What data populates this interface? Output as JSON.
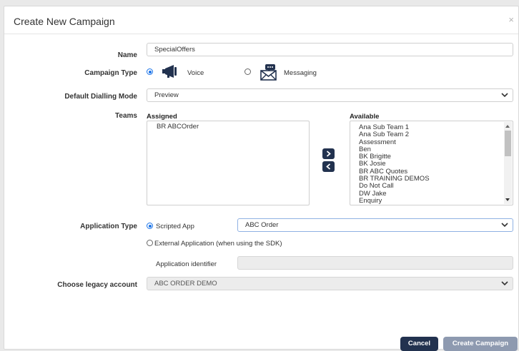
{
  "dialog": {
    "title": "Create New Campaign",
    "close_glyph": "×"
  },
  "form": {
    "name": {
      "label": "Name",
      "value": "SpecialOffers"
    },
    "campaign_type": {
      "label": "Campaign Type",
      "options": [
        {
          "label": "Voice",
          "selected": true,
          "icon": "megaphone-icon"
        },
        {
          "label": "Messaging",
          "selected": false,
          "icon": "envelope-chat-icon"
        }
      ]
    },
    "dialling_mode": {
      "label": "Default Dialling Mode",
      "value": "Preview"
    },
    "teams": {
      "label": "Teams",
      "assigned_header": "Assigned",
      "available_header": "Available",
      "assigned": [
        "BR ABCOrder"
      ],
      "available": [
        "Ana Sub Team 1",
        "Ana Sub Team 2",
        "Assessment",
        "Ben",
        "BK Brigitte",
        "BK Josie",
        "BR ABC Quotes",
        "BR TRAINING DEMOS",
        "Do Not Call",
        "DW Jake",
        "Enquiry"
      ]
    },
    "application_type": {
      "label": "Application Type",
      "scripted_label": "Scripted App",
      "scripted_value": "ABC Order",
      "external_label": "External Application (when using the SDK)",
      "identifier_label": "Application identifier",
      "identifier_value": ""
    },
    "legacy_account": {
      "label": "Choose legacy account",
      "value": "ABC ORDER DEMO"
    }
  },
  "footer": {
    "cancel_label": "Cancel",
    "create_label": "Create Campaign"
  },
  "colors": {
    "navy": "#22324f",
    "accent_blue": "#1a73e8",
    "disabled_button": "#8e9ab0"
  }
}
